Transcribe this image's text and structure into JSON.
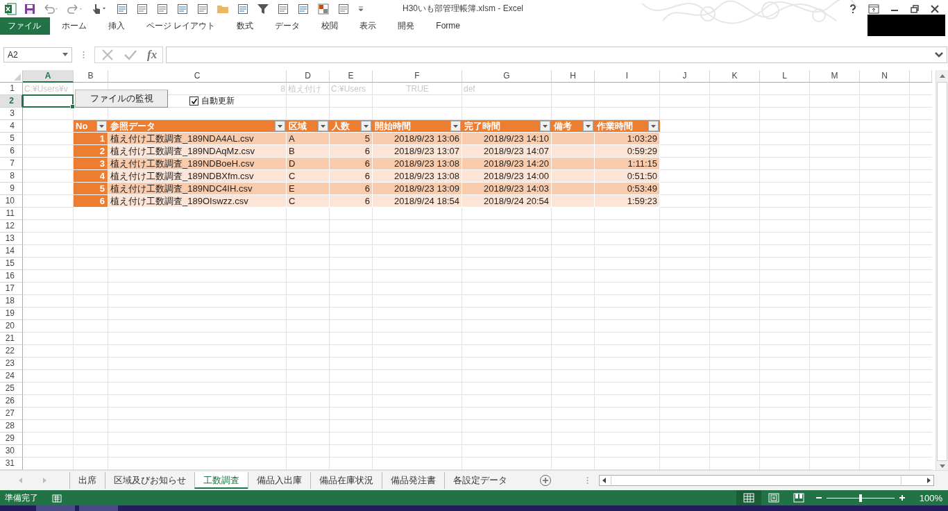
{
  "window": {
    "title": "H30いも部管理帳簿.xlsm - Excel"
  },
  "ribbon_tabs": [
    {
      "label": "ファイル",
      "selected": true
    },
    {
      "label": "ホーム",
      "selected": false
    },
    {
      "label": "挿入",
      "selected": false
    },
    {
      "label": "ページ レイアウト",
      "selected": false
    },
    {
      "label": "数式",
      "selected": false
    },
    {
      "label": "データ",
      "selected": false
    },
    {
      "label": "校閲",
      "selected": false
    },
    {
      "label": "表示",
      "selected": false
    },
    {
      "label": "開発",
      "selected": false
    },
    {
      "label": "Forme",
      "selected": false
    }
  ],
  "formula_bar": {
    "name_box": "A2",
    "fx": "fx"
  },
  "sheet": {
    "columns": [
      {
        "label": "A",
        "selected": true
      },
      {
        "label": "B",
        "selected": false
      },
      {
        "label": "C",
        "selected": false
      },
      {
        "label": "D",
        "selected": false
      },
      {
        "label": "E",
        "selected": false
      },
      {
        "label": "F",
        "selected": false
      },
      {
        "label": "G",
        "selected": false
      },
      {
        "label": "H",
        "selected": false
      },
      {
        "label": "I",
        "selected": false
      },
      {
        "label": "J",
        "selected": false
      },
      {
        "label": "K",
        "selected": false
      },
      {
        "label": "L",
        "selected": false
      },
      {
        "label": "M",
        "selected": false
      },
      {
        "label": "N",
        "selected": false
      }
    ],
    "rows": [
      {
        "label": "1",
        "selected": false
      },
      {
        "label": "2",
        "selected": true
      },
      {
        "label": "3",
        "selected": false
      },
      {
        "label": "4",
        "selected": false
      },
      {
        "label": "5",
        "selected": false
      },
      {
        "label": "6",
        "selected": false
      },
      {
        "label": "7",
        "selected": false
      },
      {
        "label": "8",
        "selected": false
      },
      {
        "label": "9",
        "selected": false
      },
      {
        "label": "10",
        "selected": false
      },
      {
        "label": "11",
        "selected": false
      },
      {
        "label": "12",
        "selected": false
      },
      {
        "label": "13",
        "selected": false
      },
      {
        "label": "14",
        "selected": false
      },
      {
        "label": "15",
        "selected": false
      },
      {
        "label": "16",
        "selected": false
      },
      {
        "label": "17",
        "selected": false
      },
      {
        "label": "18",
        "selected": false
      },
      {
        "label": "19",
        "selected": false
      },
      {
        "label": "20",
        "selected": false
      },
      {
        "label": "21",
        "selected": false
      },
      {
        "label": "22",
        "selected": false
      },
      {
        "label": "23",
        "selected": false
      },
      {
        "label": "24",
        "selected": false
      },
      {
        "label": "25",
        "selected": false
      },
      {
        "label": "26",
        "selected": false
      },
      {
        "label": "27",
        "selected": false
      },
      {
        "label": "28",
        "selected": false
      },
      {
        "label": "29",
        "selected": false
      },
      {
        "label": "30",
        "selected": false
      },
      {
        "label": "31",
        "selected": false
      }
    ]
  },
  "row_1": {
    "A": "C:¥Users¥v",
    "C": "8",
    "D": "植え付け",
    "E": "C:¥Users",
    "F": "TRUE",
    "G": "def"
  },
  "watch_button": {
    "label": "ファイルの監視"
  },
  "auto_update": {
    "label": "自動更新",
    "checked": true
  },
  "table": {
    "columns": [
      "No",
      "参照データ",
      "区域",
      "人数",
      "開始時間",
      "完了時間",
      "備考",
      "作業時間"
    ],
    "rows": [
      {
        "no": "1",
        "file": "植え付け工数調査_189NDA4AL.csv",
        "area": "A",
        "people": "5",
        "start": "2018/9/23 13:06",
        "end": "2018/9/23 14:10",
        "duration": "1:03:29"
      },
      {
        "no": "2",
        "file": "植え付け工数調査_189NDAqMz.csv",
        "area": "B",
        "people": "6",
        "start": "2018/9/23 13:07",
        "end": "2018/9/23 14:07",
        "duration": "0:59:29"
      },
      {
        "no": "3",
        "file": "植え付け工数調査_189NDBoeH.csv",
        "area": "D",
        "people": "6",
        "start": "2018/9/23 13:08",
        "end": "2018/9/23 14:20",
        "duration": "1:11:15"
      },
      {
        "no": "4",
        "file": "植え付け工数調査_189NDBXfm.csv",
        "area": "C",
        "people": "6",
        "start": "2018/9/23 13:08",
        "end": "2018/9/23 14:00",
        "duration": "0:51:50"
      },
      {
        "no": "5",
        "file": "植え付け工数調査_189NDC4IH.csv",
        "area": "E",
        "people": "6",
        "start": "2018/9/23 13:09",
        "end": "2018/9/23 14:03",
        "duration": "0:53:49"
      },
      {
        "no": "6",
        "file": "植え付け工数調査_189OIswzz.csv",
        "area": "C",
        "people": "6",
        "start": "2018/9/24 18:54",
        "end": "2018/9/24 20:54",
        "duration": "1:59:23"
      }
    ]
  },
  "sheet_tabs": [
    {
      "label": "出席",
      "selected": false
    },
    {
      "label": "区域及びお知らせ",
      "selected": false
    },
    {
      "label": "工数調査",
      "selected": true
    },
    {
      "label": "備品入出庫",
      "selected": false
    },
    {
      "label": "備品在庫状況",
      "selected": false
    },
    {
      "label": "備品発注書",
      "selected": false
    },
    {
      "label": "各設定データ",
      "selected": false
    }
  ],
  "status_bar": {
    "status": "準備完了",
    "views": [
      {
        "kind": "normal",
        "selected": true
      },
      {
        "kind": "page_layout",
        "selected": false
      },
      {
        "kind": "page_break",
        "selected": false
      }
    ],
    "zoom": {
      "level": 0.5,
      "reading": "100%"
    }
  }
}
